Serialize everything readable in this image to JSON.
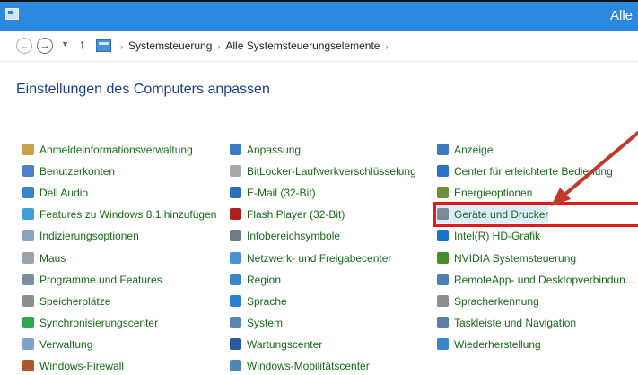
{
  "window": {
    "title": "Alle"
  },
  "nav": {
    "back_glyph": "←",
    "forward_glyph": "→",
    "dropdown_glyph": "▼",
    "up_glyph": "↑",
    "breadcrumbs": [
      "Systemsteuerung",
      "Alle Systemsteuerungselemente"
    ],
    "separator": "›"
  },
  "page_title": "Einstellungen des Computers anpassen",
  "columns": [
    [
      {
        "label": "Anmeldeinformationsverwaltung",
        "icon": "credential-icon",
        "color": "#c9a14a"
      },
      {
        "label": "Benutzerkonten",
        "icon": "users-icon",
        "color": "#4f7fc4"
      },
      {
        "label": "Dell Audio",
        "icon": "dell-audio-icon",
        "color": "#3a86c7"
      },
      {
        "label": "Features zu Windows 8.1 hinzufügen",
        "icon": "windows-features-icon",
        "color": "#3aa0d8"
      },
      {
        "label": "Indizierungsoptionen",
        "icon": "indexing-icon",
        "color": "#8da3bd"
      },
      {
        "label": "Maus",
        "icon": "mouse-icon",
        "color": "#9aa2aa"
      },
      {
        "label": "Programme und Features",
        "icon": "programs-icon",
        "color": "#7d8f9f"
      },
      {
        "label": "Speicherplätze",
        "icon": "storage-icon",
        "color": "#8a8f94"
      },
      {
        "label": "Synchronisierungscenter",
        "icon": "sync-icon",
        "color": "#2ea84a"
      },
      {
        "label": "Verwaltung",
        "icon": "admin-tools-icon",
        "color": "#7ea2c9"
      },
      {
        "label": "Windows-Firewall",
        "icon": "firewall-icon",
        "color": "#b0562f"
      }
    ],
    [
      {
        "label": "Anpassung",
        "icon": "personalization-icon",
        "color": "#3a7cc8"
      },
      {
        "label": "BitLocker-Laufwerkverschlüsselung",
        "icon": "bitlocker-icon",
        "color": "#a9a9a9"
      },
      {
        "label": "E-Mail (32-Bit)",
        "icon": "mail-icon",
        "color": "#2a6fb7"
      },
      {
        "label": "Flash Player (32-Bit)",
        "icon": "flash-icon",
        "color": "#b01e1e"
      },
      {
        "label": "Infobereichsymbole",
        "icon": "notification-icon",
        "color": "#6f7a85"
      },
      {
        "label": "Netzwerk- und Freigabecenter",
        "icon": "network-icon",
        "color": "#4a90d9"
      },
      {
        "label": "Region",
        "icon": "region-icon",
        "color": "#3a86c7"
      },
      {
        "label": "Sprache",
        "icon": "language-icon",
        "color": "#2c7fd0"
      },
      {
        "label": "System",
        "icon": "system-icon",
        "color": "#5a86b4"
      },
      {
        "label": "Wartungscenter",
        "icon": "action-center-icon",
        "color": "#2c5aa0"
      },
      {
        "label": "Windows-Mobilitätscenter",
        "icon": "mobility-icon",
        "color": "#4f86b8"
      }
    ],
    [
      {
        "label": "Anzeige",
        "icon": "display-icon",
        "color": "#3b7bc2"
      },
      {
        "label": "Center für erleichterte Bedienung",
        "icon": "ease-of-access-icon",
        "color": "#2f6fc8"
      },
      {
        "label": "Energieoptionen",
        "icon": "power-icon",
        "color": "#6b8e3a"
      },
      {
        "label": "Geräte und Drucker",
        "icon": "devices-printers-icon",
        "color": "#7a8a99"
      },
      {
        "label": "Intel(R) HD-Grafik",
        "icon": "intel-graphics-icon",
        "color": "#1a73c9"
      },
      {
        "label": "NVIDIA Systemsteuerung",
        "icon": "nvidia-icon",
        "color": "#4a8c2a"
      },
      {
        "label": "RemoteApp- und Desktopverbindun...",
        "icon": "remoteapp-icon",
        "color": "#4a7fb5"
      },
      {
        "label": "Spracherkennung",
        "icon": "speech-icon",
        "color": "#8a8f94"
      },
      {
        "label": "Taskleiste und Navigation",
        "icon": "taskbar-icon",
        "color": "#5a7ea8"
      },
      {
        "label": "Wiederherstellung",
        "icon": "recovery-icon",
        "color": "#3a86c7"
      }
    ]
  ],
  "highlight": {
    "label": "Geräte und Drucker",
    "box_color": "#e01b1b",
    "arrow_color": "#c0392b"
  }
}
